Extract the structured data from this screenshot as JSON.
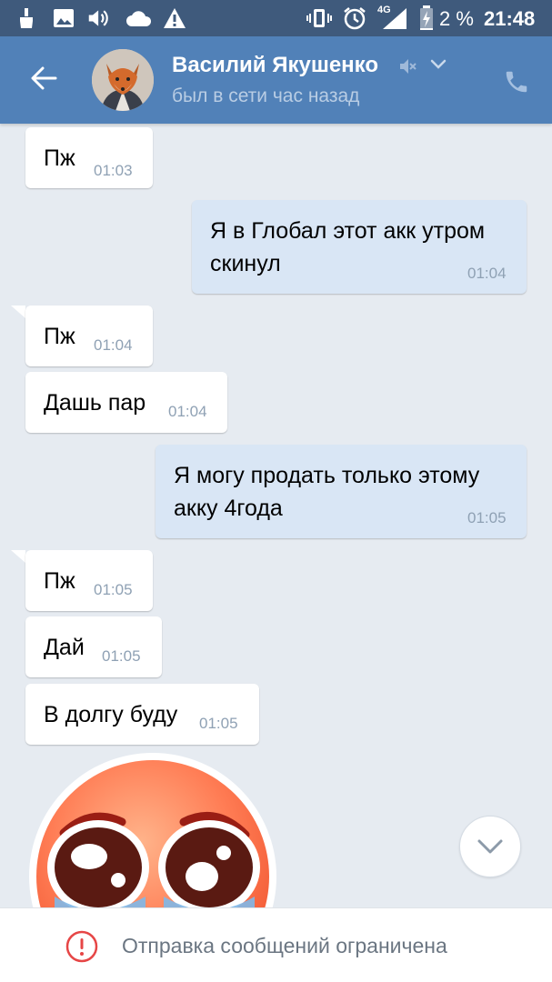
{
  "status_bar": {
    "battery": "2 %",
    "time": "21:48",
    "network": "4G",
    "icons": [
      "broom-icon",
      "image-icon",
      "volume-icon",
      "cloud-icon",
      "warning-icon",
      "vibrate-icon",
      "alarm-icon",
      "signal-icon",
      "battery-charging-icon"
    ]
  },
  "header": {
    "contact_name": "Василий Якушенко",
    "last_seen": "был в сети час назад",
    "icons": [
      "back-arrow-icon",
      "avatar-fox",
      "mute-icon",
      "chevron-down-icon",
      "phone-icon"
    ]
  },
  "messages": [
    {
      "dir": "in",
      "text": "Пж",
      "time": "01:03"
    },
    {
      "dir": "out",
      "text": "Я в Глобал этот акк утром скинул",
      "time": "01:04"
    },
    {
      "dir": "in",
      "text": "Пж",
      "time": "01:04"
    },
    {
      "dir": "in",
      "text": "Дашь пар",
      "time": "01:04"
    },
    {
      "dir": "out",
      "text": "Я могу продать только этому акку 4года",
      "time": "01:05"
    },
    {
      "dir": "in",
      "text": "Пж",
      "time": "01:05"
    },
    {
      "dir": "in",
      "text": "Дай",
      "time": "01:05"
    },
    {
      "dir": "in",
      "text": "В долгу буду",
      "time": "01:05"
    }
  ],
  "sticker": {
    "name": "pleading-face-sticker"
  },
  "footer": {
    "restriction_text": "Отправка сообщений ограничена"
  },
  "colors": {
    "header": "#5181b8",
    "status_bar": "#3f5a7c",
    "chat_bg": "#e6ebf1",
    "outgoing_bubble": "#d9e6f5",
    "incoming_bubble": "#ffffff",
    "warning": "#e64646"
  }
}
